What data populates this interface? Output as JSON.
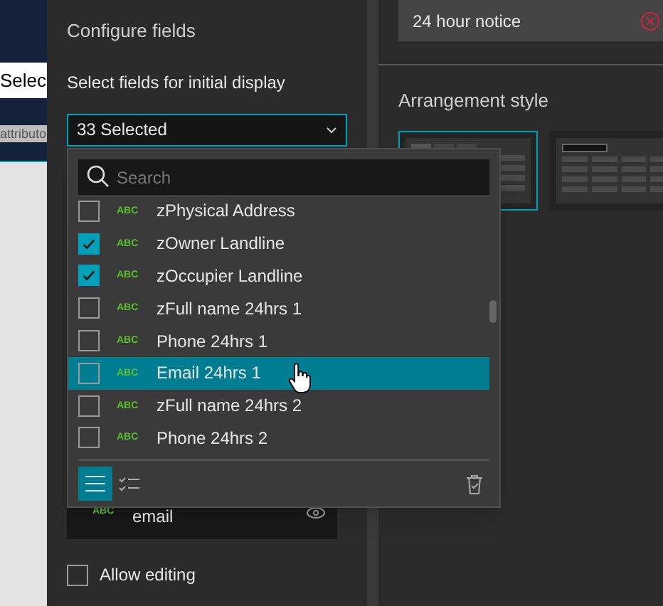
{
  "background_app": {
    "field_value": "Selec",
    "bar_text": "attributo"
  },
  "configure_panel": {
    "title": "Configure fields",
    "label": "Select fields for initial display",
    "dropdown": {
      "value": "33 Selected",
      "expanded": true
    },
    "field_card": {
      "type_badge": "ABC",
      "name": "email"
    },
    "allow_editing": {
      "label": "Allow editing",
      "checked": false
    }
  },
  "field_popup": {
    "search": {
      "placeholder": "Search"
    },
    "items": [
      {
        "type_badge": "ABC",
        "label": "zPhysical Address",
        "checked": false,
        "selected": false
      },
      {
        "type_badge": "ABC",
        "label": "zOwner Landline",
        "checked": true,
        "selected": false
      },
      {
        "type_badge": "ABC",
        "label": "zOccupier Landline",
        "checked": true,
        "selected": false
      },
      {
        "type_badge": "ABC",
        "label": "zFull name 24hrs 1",
        "checked": false,
        "selected": false
      },
      {
        "type_badge": "ABC",
        "label": "Phone 24hrs 1",
        "checked": false,
        "selected": false
      },
      {
        "type_badge": "ABC",
        "label": "Email 24hrs 1",
        "checked": false,
        "selected": true
      },
      {
        "type_badge": "ABC",
        "label": "zFull name 24hrs 2",
        "checked": false,
        "selected": false
      },
      {
        "type_badge": "ABC",
        "label": "Phone 24hrs 2",
        "checked": false,
        "selected": false
      }
    ],
    "view_modes": [
      {
        "kind": "list",
        "selected": true
      },
      {
        "kind": "checked",
        "selected": false
      }
    ]
  },
  "right_panel": {
    "notice": "24 hour notice",
    "arrangement_title": "Arrangement style",
    "styles": [
      {
        "kind": "tabs",
        "selected": true
      },
      {
        "kind": "dropdown",
        "selected": false
      }
    ]
  }
}
